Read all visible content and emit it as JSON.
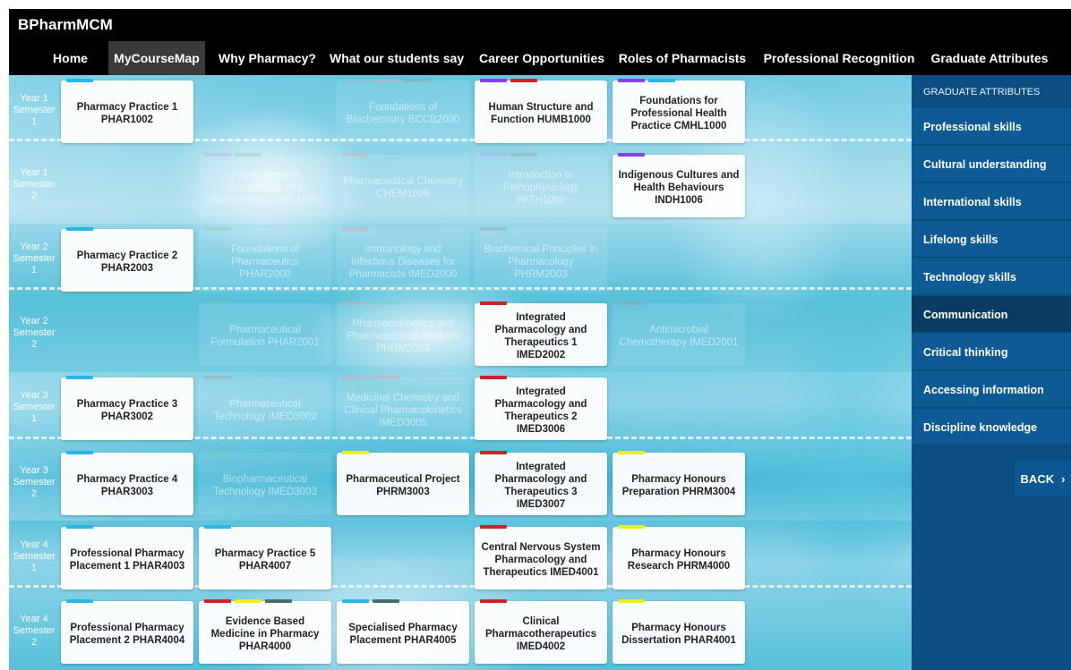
{
  "app": {
    "title": "BPharmMCM"
  },
  "nav": {
    "items": [
      {
        "label": "Home",
        "active": false
      },
      {
        "label": "MyCourseMap",
        "active": true
      },
      {
        "label": "Why Pharmacy?",
        "active": false
      },
      {
        "label": "What our students say",
        "active": false
      },
      {
        "label": "Career Opportunities",
        "active": false
      },
      {
        "label": "Roles of Pharmacists",
        "active": false
      },
      {
        "label": "Professional Recognition",
        "active": false
      },
      {
        "label": "Graduate Attributes",
        "active": false
      }
    ]
  },
  "colors": {
    "blue": "#29b6e6",
    "purple": "#8a3fe0",
    "red": "#d41f26",
    "yellow": "#e9f01c",
    "slate": "#4a6b6b",
    "lavender": "#b6a8e6",
    "pink": "#e8a0a8",
    "grey": "#9a9a9a",
    "green": "#88c8a0"
  },
  "semesters": [
    {
      "label": "Year 1 Semester 1"
    },
    {
      "label": "Year 1 Semester 2"
    },
    {
      "label": "Year 2 Semester 1"
    },
    {
      "label": "Year 2 Semester 2"
    },
    {
      "label": "Year 3 Semester 1"
    },
    {
      "label": "Year 3 Semester 2"
    },
    {
      "label": "Year 4 Semester 1"
    },
    {
      "label": "Year 4 Semester 2"
    }
  ],
  "courses": [
    {
      "row": 0,
      "col": 0,
      "text": "Pharmacy Practice 1 PHAR1002",
      "faded": false,
      "bars": [
        "blue"
      ]
    },
    {
      "row": 0,
      "col": 2,
      "text": "Foundations of Biochemistry BCCB2000",
      "faded": true,
      "bars": [
        "lavender",
        "pink",
        "grey"
      ]
    },
    {
      "row": 0,
      "col": 3,
      "text": "Human Structure and Function HUMB1000",
      "faded": false,
      "bars": [
        "purple",
        "red"
      ]
    },
    {
      "row": 0,
      "col": 4,
      "text": "Foundations for Professional Health Practice CMHL1000",
      "faded": false,
      "bars": [
        "purple",
        "blue"
      ]
    },
    {
      "row": 1,
      "col": 1,
      "text": "Foundations of Biosciences and Biochemistry EPID1000",
      "faded": true,
      "bars": [
        "lavender",
        "green"
      ]
    },
    {
      "row": 1,
      "col": 2,
      "text": "Pharmaceutical Chemistry CHEM1006",
      "faded": true,
      "bars": [
        "pink"
      ]
    },
    {
      "row": 1,
      "col": 3,
      "text": "Introduction to Pathophysiology PATH1000",
      "faded": true,
      "bars": [
        "lavender",
        "grey"
      ]
    },
    {
      "row": 1,
      "col": 4,
      "text": "Indigenous Cultures and Health Behaviours INDH1006",
      "faded": false,
      "bars": [
        "purple"
      ]
    },
    {
      "row": 2,
      "col": 0,
      "text": "Pharmacy Practice 2 PHAR2003",
      "faded": false,
      "bars": [
        "blue"
      ]
    },
    {
      "row": 2,
      "col": 1,
      "text": "Foundations of Pharmaceutics PHAR2000",
      "faded": true,
      "bars": [
        "green"
      ]
    },
    {
      "row": 2,
      "col": 2,
      "text": "Immunology and Infectious Diseases for Pharmacists IMED2000",
      "faded": true,
      "bars": [
        "pink"
      ]
    },
    {
      "row": 2,
      "col": 3,
      "text": "Biochemical Principles in Pharmacology PHRM2003",
      "faded": true,
      "bars": [
        "grey"
      ]
    },
    {
      "row": 3,
      "col": 1,
      "text": "Pharmaceutical Formulation PHAR2001",
      "faded": true,
      "bars": [
        "green"
      ]
    },
    {
      "row": 3,
      "col": 2,
      "text": "Pharmacokinetics and Pharmaceutical Analysis PHRM2004",
      "faded": true,
      "bars": [
        "pink",
        "green"
      ]
    },
    {
      "row": 3,
      "col": 3,
      "text": "Integrated Pharmacology and Therapeutics 1 IMED2002",
      "faded": false,
      "bars": [
        "red"
      ]
    },
    {
      "row": 3,
      "col": 4,
      "text": "Antimicrobial Chemotherapy IMED2001",
      "faded": true,
      "bars": [
        "grey"
      ]
    },
    {
      "row": 4,
      "col": 0,
      "text": "Pharmacy Practice 3 PHAR3002",
      "faded": false,
      "bars": [
        "blue"
      ]
    },
    {
      "row": 4,
      "col": 1,
      "text": "Pharmaceutical Technology IMED3002",
      "faded": true,
      "bars": [
        "grey"
      ]
    },
    {
      "row": 4,
      "col": 2,
      "text": "Medicinal Chemistry and Clinical Pharmacokinetics IMED3005",
      "faded": true,
      "bars": [
        "pink",
        "pink"
      ]
    },
    {
      "row": 4,
      "col": 3,
      "text": "Integrated Pharmacology and Therapeutics 2 IMED3006",
      "faded": false,
      "bars": [
        "red"
      ]
    },
    {
      "row": 5,
      "col": 0,
      "text": "Pharmacy Practice 4 PHAR3003",
      "faded": false,
      "bars": [
        "blue"
      ]
    },
    {
      "row": 5,
      "col": 1,
      "text": "Biopharmaceutical Technology IMED3003",
      "faded": true,
      "bars": [
        "green"
      ]
    },
    {
      "row": 5,
      "col": 2,
      "text": "Pharmaceutical Project PHRM3003",
      "faded": false,
      "bars": [
        "yellow"
      ]
    },
    {
      "row": 5,
      "col": 3,
      "text": "Integrated Pharmacology and Therapeutics 3 IMED3007",
      "faded": false,
      "bars": [
        "red"
      ]
    },
    {
      "row": 5,
      "col": 4,
      "text": "Pharmacy Honours Preparation PHRM3004",
      "faded": false,
      "bars": [
        "yellow"
      ]
    },
    {
      "row": 6,
      "col": 0,
      "text": "Professional Pharmacy Placement 1 PHAR4003",
      "faded": false,
      "bars": [
        "blue"
      ]
    },
    {
      "row": 6,
      "col": 1,
      "text": "Pharmacy Practice 5 PHAR4007",
      "faded": false,
      "bars": [
        "blue"
      ]
    },
    {
      "row": 6,
      "col": 3,
      "text": "Central Nervous System Pharmacology and Therapeutics IMED4001",
      "faded": false,
      "bars": [
        "red"
      ]
    },
    {
      "row": 6,
      "col": 4,
      "text": "Pharmacy Honours Research PHRM4000",
      "faded": false,
      "bars": [
        "yellow"
      ]
    },
    {
      "row": 7,
      "col": 0,
      "text": "Professional Pharmacy Placement 2 PHAR4004",
      "faded": false,
      "bars": [
        "blue"
      ]
    },
    {
      "row": 7,
      "col": 1,
      "text": "Evidence Based Medicine in Pharmacy PHAR4000",
      "faded": false,
      "bars": [
        "red",
        "yellow",
        "slate"
      ]
    },
    {
      "row": 7,
      "col": 2,
      "text": "Specialised Pharmacy Placement PHAR4005",
      "faded": false,
      "bars": [
        "blue",
        "slate"
      ]
    },
    {
      "row": 7,
      "col": 3,
      "text": "Clinical Pharmacotherapeutics IMED4002",
      "faded": false,
      "bars": [
        "red"
      ]
    },
    {
      "row": 7,
      "col": 4,
      "text": "Pharmacy Honours Dissertation PHAR4001",
      "faded": false,
      "bars": [
        "yellow"
      ]
    }
  ],
  "sidebar": {
    "header": "GRADUATE ATTRIBUTES",
    "items": [
      {
        "label": "Professional skills",
        "active": false
      },
      {
        "label": "Cultural understanding",
        "active": false
      },
      {
        "label": "International skills",
        "active": false
      },
      {
        "label": "Lifelong skills",
        "active": false
      },
      {
        "label": "Technology skills",
        "active": false
      },
      {
        "label": "Communication",
        "active": true
      },
      {
        "label": "Critical thinking",
        "active": false
      },
      {
        "label": "Accessing information",
        "active": false
      },
      {
        "label": "Discipline knowledge",
        "active": false
      }
    ],
    "back_label": "BACK",
    "back_icon": "chevron-right-icon"
  }
}
